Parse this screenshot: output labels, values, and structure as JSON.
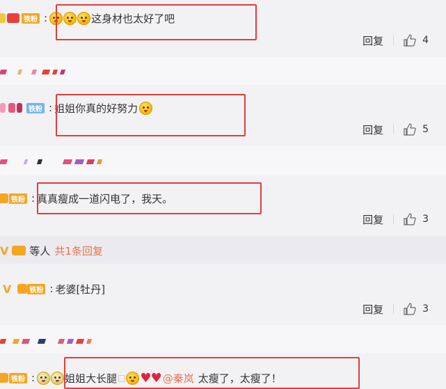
{
  "comments": [
    {
      "badge": "铁粉",
      "badge_color": "#f5a623",
      "emojis": 3,
      "text": "这身材也太好了吧",
      "reply_label": "回复",
      "likes": "4"
    },
    {
      "badge": "铁粉",
      "badge_color": "#74b5ea",
      "text": "姐姐你真的好努力",
      "reply_label": "回复",
      "likes": "5"
    },
    {
      "badge": "铁粉",
      "badge_color": "#f5a623",
      "text": "真真瘦成一道闪电了，我天。",
      "reply_label": "回复",
      "likes": "3"
    },
    {
      "badge": "铁粉",
      "badge_color": "#f5a623",
      "text": "老婆[牡丹]",
      "reply_label": "回复",
      "likes": "3"
    },
    {
      "badge": "铁粉",
      "badge_color": "#f5a623",
      "text": "姐姐大长腿",
      "mention": "@秦岚",
      "tail": "太瘦了，太瘦了！"
    }
  ],
  "reply_summary": {
    "others": "等人",
    "more_link": "共1条回复"
  },
  "colors": {
    "page_bg": "#f2f2f5",
    "highlight_box": "#e43b3b",
    "link_orange": "#eb7350"
  },
  "icons": {
    "like": "thumbs-up-icon",
    "vip": "vip-v-icon"
  }
}
